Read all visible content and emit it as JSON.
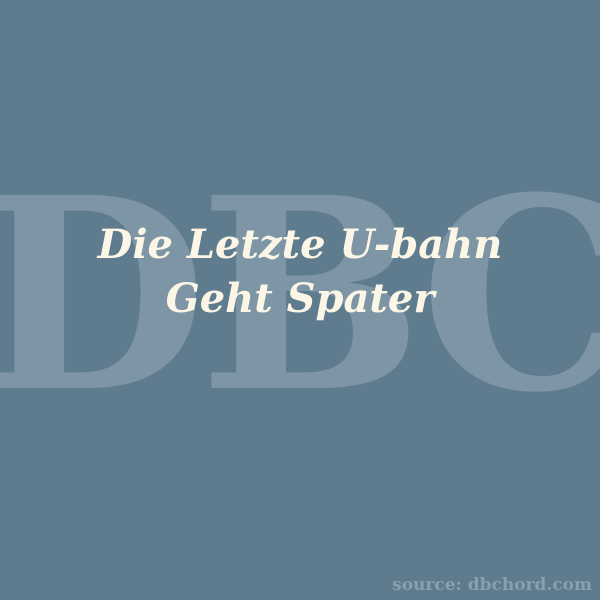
{
  "colors": {
    "background": "#5f7b8e",
    "watermark": "#7d95a5",
    "title": "#fbf6e6",
    "source": "#8aa0ae"
  },
  "watermark": {
    "text": "DBC"
  },
  "title": {
    "line1": "Die Letzte U-bahn",
    "line2": "Geht Spater"
  },
  "source": {
    "text": "source: dbchord.com"
  }
}
